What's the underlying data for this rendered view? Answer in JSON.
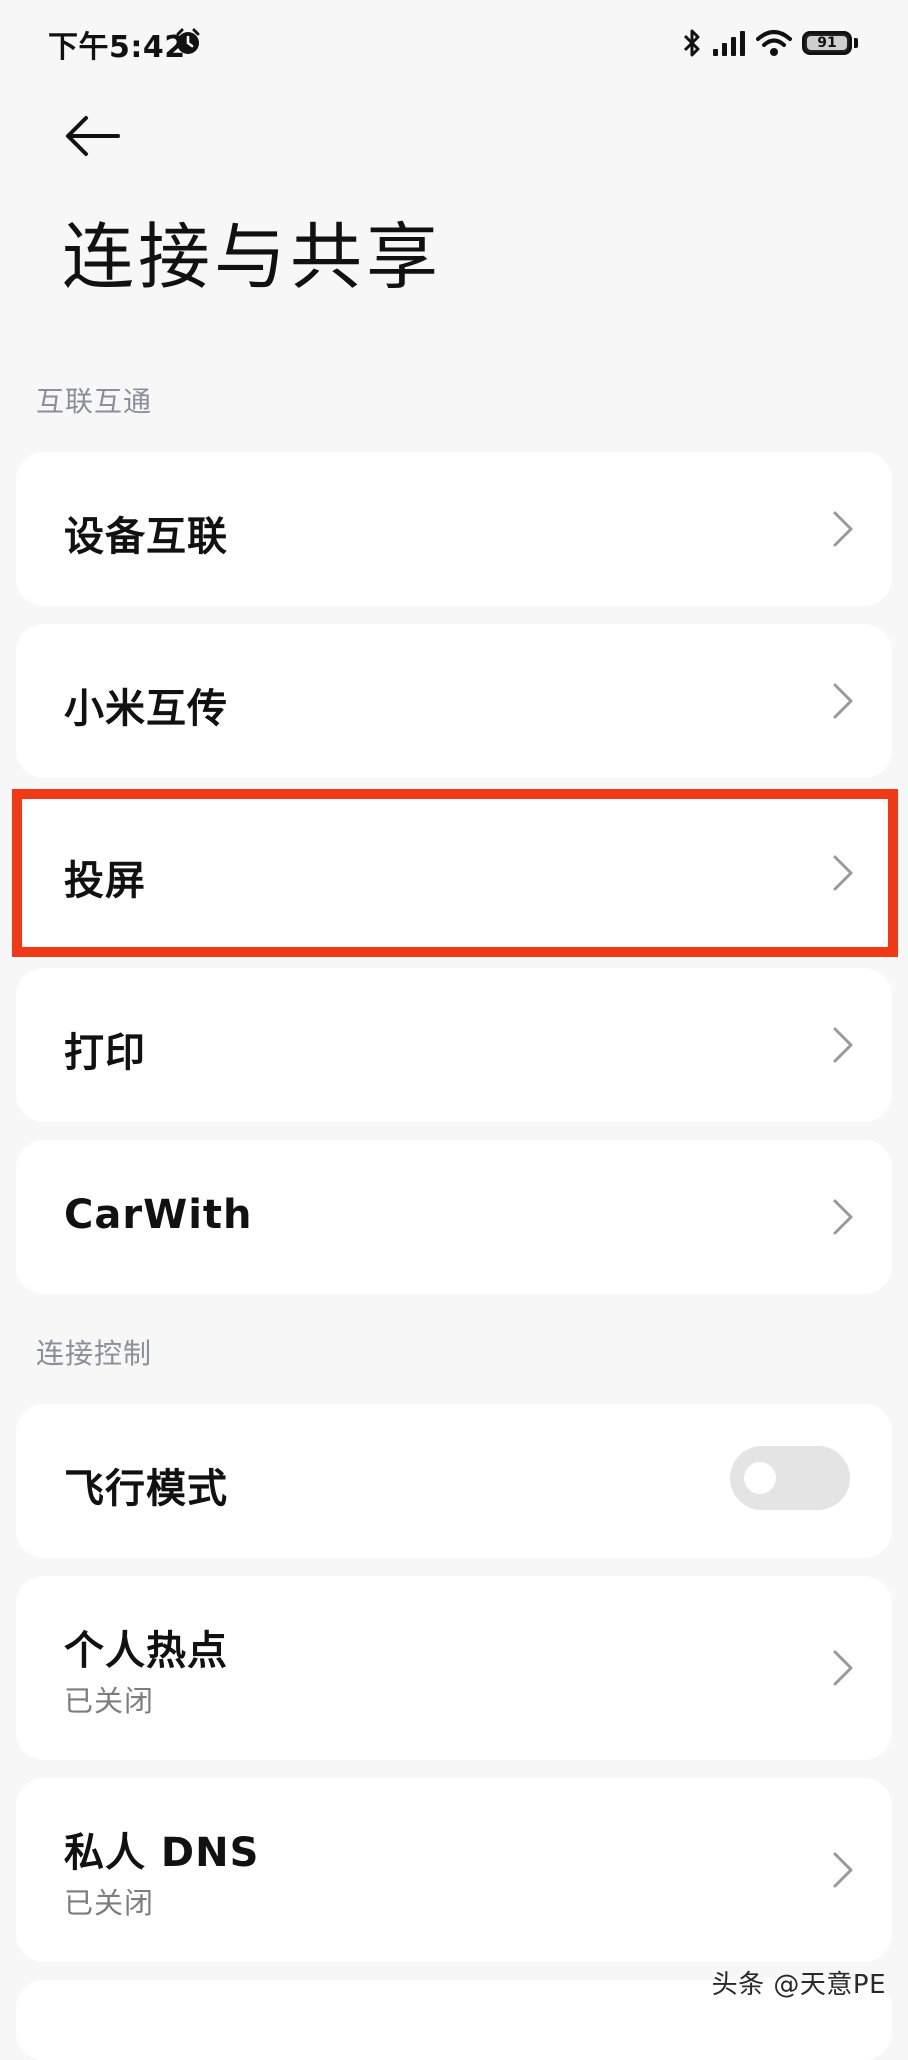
{
  "status_bar": {
    "time": "下午5:42",
    "battery_level": "91",
    "icons": [
      "alarm-icon",
      "bluetooth-icon",
      "signal-icon",
      "wifi-icon",
      "battery-icon"
    ]
  },
  "header": {
    "back_icon": "arrow-left-icon",
    "title": "连接与共享"
  },
  "sections": [
    {
      "header": "互联互通",
      "items": [
        {
          "label": "设备互联",
          "chevron": true
        },
        {
          "label": "小米互传",
          "chevron": true
        },
        {
          "label": "投屏",
          "chevron": true,
          "highlighted": true
        },
        {
          "label": "打印",
          "chevron": true
        },
        {
          "label": "CarWith",
          "chevron": true
        }
      ]
    },
    {
      "header": "连接控制",
      "items": [
        {
          "label": "飞行模式",
          "toggle": false
        },
        {
          "label": "个人热点",
          "subtitle": "已关闭",
          "chevron": true
        },
        {
          "label": "私人 DNS",
          "subtitle": "已关闭",
          "chevron": true
        }
      ]
    }
  ],
  "highlight_color": "#f03a17",
  "watermark": "头条 @天意PE"
}
